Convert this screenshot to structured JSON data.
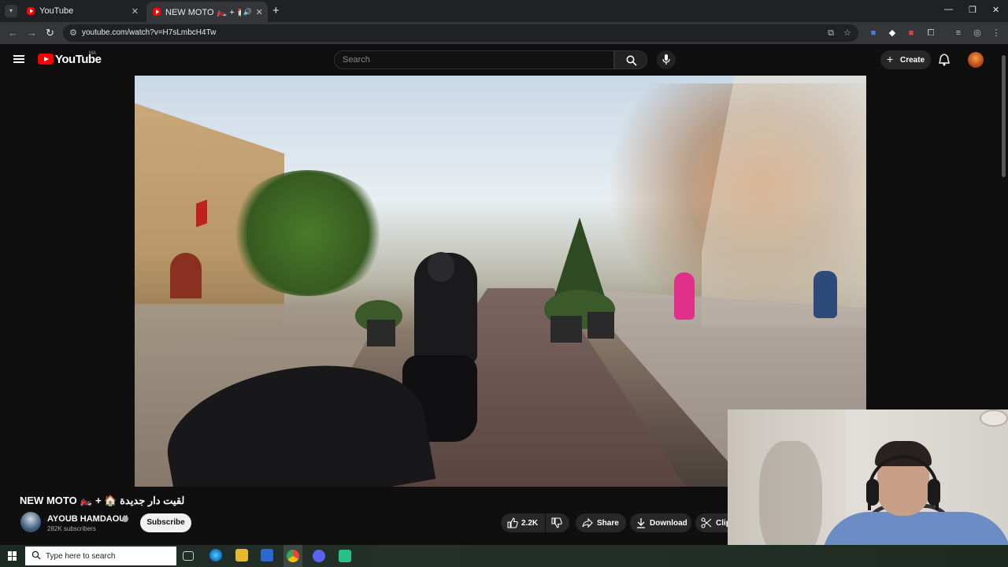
{
  "browser": {
    "tabs": [
      {
        "title": "YouTube",
        "active": false
      },
      {
        "title": "NEW MOTO 🏍️ + 🏠 لقيت دار جديدة",
        "active": true
      }
    ],
    "url": "youtube.com/watch?v=H7sLmbcH4Tw"
  },
  "youtube": {
    "logo_text": "YouTube",
    "country_code": "MA",
    "search_placeholder": "Search",
    "create_label": "Create"
  },
  "video": {
    "title": "NEW MOTO 🏍️ + 🏠 لقيت دار جديدة",
    "channel_name": "AYOUB HAMDAOUI",
    "subscribers": "282K subscribers",
    "subscribe_label": "Subscribe",
    "likes": "2.2K",
    "share_label": "Share",
    "download_label": "Download",
    "clip_label": "Clip"
  },
  "taskbar": {
    "search_placeholder": "Type here to search"
  },
  "colors": {
    "youtube_red": "#ff0000",
    "background": "#0f0f0f",
    "pill": "#272727"
  }
}
